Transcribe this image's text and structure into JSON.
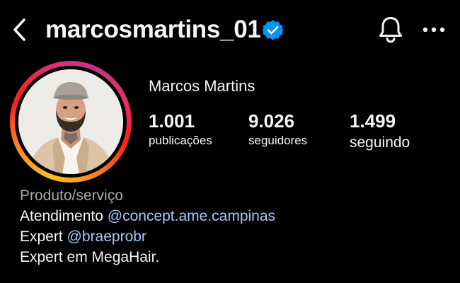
{
  "header": {
    "username": "marcosmartins_01",
    "verified": true,
    "icons": {
      "back": "chevron-left-icon",
      "verified": "verified-badge-icon",
      "notifications": "bell-icon",
      "more": "more-horizontal-icon"
    }
  },
  "profile": {
    "display_name": "Marcos Martins",
    "stats": [
      {
        "value": "1.001",
        "label": "publicações"
      },
      {
        "value": "9.026",
        "label": "seguidores"
      },
      {
        "value": "1.499",
        "label": "seguindo"
      }
    ]
  },
  "bio": {
    "category": "Produto/serviço",
    "line1_prefix": "Atendimento",
    "line1_mention": "@concept.ame.campinas",
    "line2_prefix": "Expert",
    "line2_mention": "@braeprobr",
    "line3": "Expert em MegaHair."
  },
  "colors": {
    "background": "#000000",
    "text": "#f5f5f5",
    "muted": "#a8a8a8",
    "link": "#a8c7fa",
    "verified": "#0095f6"
  }
}
